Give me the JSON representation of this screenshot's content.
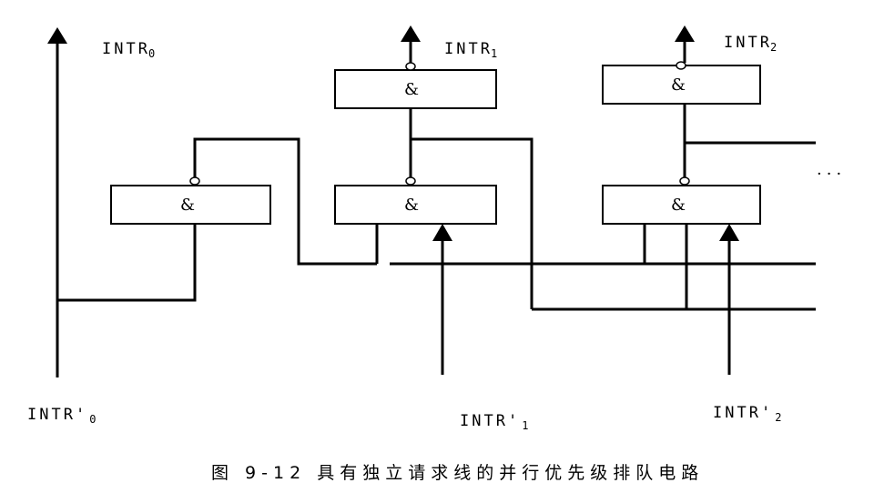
{
  "labels": {
    "intr0": {
      "base": "INTR",
      "sub": "0"
    },
    "intr1": {
      "base": "INTR",
      "sub": "1"
    },
    "intr2": {
      "base": "INTR",
      "sub": "2"
    },
    "intr0_in": {
      "base": "INTR'",
      "sub": "0"
    },
    "intr1_in": {
      "base": "INTR'",
      "sub": "1"
    },
    "intr2_in": {
      "base": "INTR'",
      "sub": "2"
    }
  },
  "gate_symbol": "&",
  "ellipsis": "···",
  "caption": "图 9-12 具有独立请求线的并行优先级排队电路"
}
